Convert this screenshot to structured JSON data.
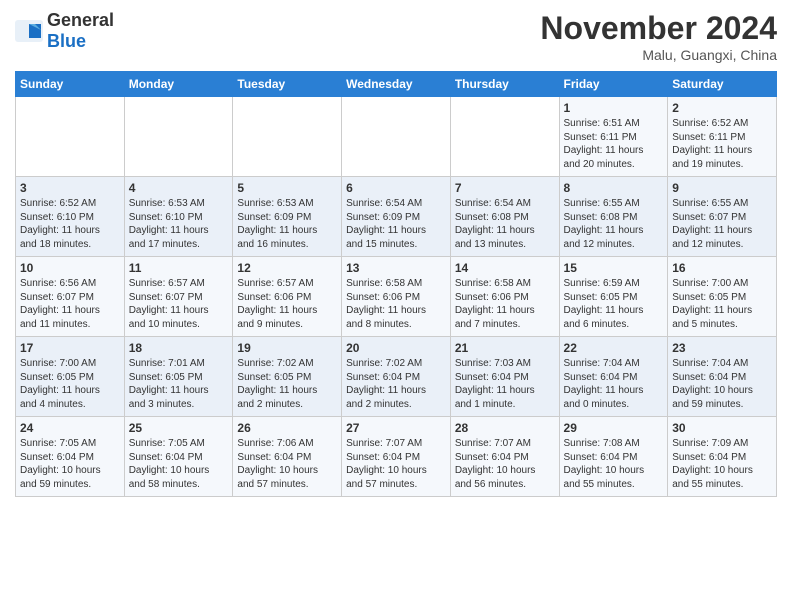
{
  "header": {
    "logo_general": "General",
    "logo_blue": "Blue",
    "month": "November 2024",
    "location": "Malu, Guangxi, China"
  },
  "weekdays": [
    "Sunday",
    "Monday",
    "Tuesday",
    "Wednesday",
    "Thursday",
    "Friday",
    "Saturday"
  ],
  "weeks": [
    [
      {
        "day": "",
        "content": ""
      },
      {
        "day": "",
        "content": ""
      },
      {
        "day": "",
        "content": ""
      },
      {
        "day": "",
        "content": ""
      },
      {
        "day": "",
        "content": ""
      },
      {
        "day": "1",
        "content": "Sunrise: 6:51 AM\nSunset: 6:11 PM\nDaylight: 11 hours\nand 20 minutes."
      },
      {
        "day": "2",
        "content": "Sunrise: 6:52 AM\nSunset: 6:11 PM\nDaylight: 11 hours\nand 19 minutes."
      }
    ],
    [
      {
        "day": "3",
        "content": "Sunrise: 6:52 AM\nSunset: 6:10 PM\nDaylight: 11 hours\nand 18 minutes."
      },
      {
        "day": "4",
        "content": "Sunrise: 6:53 AM\nSunset: 6:10 PM\nDaylight: 11 hours\nand 17 minutes."
      },
      {
        "day": "5",
        "content": "Sunrise: 6:53 AM\nSunset: 6:09 PM\nDaylight: 11 hours\nand 16 minutes."
      },
      {
        "day": "6",
        "content": "Sunrise: 6:54 AM\nSunset: 6:09 PM\nDaylight: 11 hours\nand 15 minutes."
      },
      {
        "day": "7",
        "content": "Sunrise: 6:54 AM\nSunset: 6:08 PM\nDaylight: 11 hours\nand 13 minutes."
      },
      {
        "day": "8",
        "content": "Sunrise: 6:55 AM\nSunset: 6:08 PM\nDaylight: 11 hours\nand 12 minutes."
      },
      {
        "day": "9",
        "content": "Sunrise: 6:55 AM\nSunset: 6:07 PM\nDaylight: 11 hours\nand 12 minutes."
      }
    ],
    [
      {
        "day": "10",
        "content": "Sunrise: 6:56 AM\nSunset: 6:07 PM\nDaylight: 11 hours\nand 11 minutes."
      },
      {
        "day": "11",
        "content": "Sunrise: 6:57 AM\nSunset: 6:07 PM\nDaylight: 11 hours\nand 10 minutes."
      },
      {
        "day": "12",
        "content": "Sunrise: 6:57 AM\nSunset: 6:06 PM\nDaylight: 11 hours\nand 9 minutes."
      },
      {
        "day": "13",
        "content": "Sunrise: 6:58 AM\nSunset: 6:06 PM\nDaylight: 11 hours\nand 8 minutes."
      },
      {
        "day": "14",
        "content": "Sunrise: 6:58 AM\nSunset: 6:06 PM\nDaylight: 11 hours\nand 7 minutes."
      },
      {
        "day": "15",
        "content": "Sunrise: 6:59 AM\nSunset: 6:05 PM\nDaylight: 11 hours\nand 6 minutes."
      },
      {
        "day": "16",
        "content": "Sunrise: 7:00 AM\nSunset: 6:05 PM\nDaylight: 11 hours\nand 5 minutes."
      }
    ],
    [
      {
        "day": "17",
        "content": "Sunrise: 7:00 AM\nSunset: 6:05 PM\nDaylight: 11 hours\nand 4 minutes."
      },
      {
        "day": "18",
        "content": "Sunrise: 7:01 AM\nSunset: 6:05 PM\nDaylight: 11 hours\nand 3 minutes."
      },
      {
        "day": "19",
        "content": "Sunrise: 7:02 AM\nSunset: 6:05 PM\nDaylight: 11 hours\nand 2 minutes."
      },
      {
        "day": "20",
        "content": "Sunrise: 7:02 AM\nSunset: 6:04 PM\nDaylight: 11 hours\nand 2 minutes."
      },
      {
        "day": "21",
        "content": "Sunrise: 7:03 AM\nSunset: 6:04 PM\nDaylight: 11 hours\nand 1 minute."
      },
      {
        "day": "22",
        "content": "Sunrise: 7:04 AM\nSunset: 6:04 PM\nDaylight: 11 hours\nand 0 minutes."
      },
      {
        "day": "23",
        "content": "Sunrise: 7:04 AM\nSunset: 6:04 PM\nDaylight: 10 hours\nand 59 minutes."
      }
    ],
    [
      {
        "day": "24",
        "content": "Sunrise: 7:05 AM\nSunset: 6:04 PM\nDaylight: 10 hours\nand 59 minutes."
      },
      {
        "day": "25",
        "content": "Sunrise: 7:05 AM\nSunset: 6:04 PM\nDaylight: 10 hours\nand 58 minutes."
      },
      {
        "day": "26",
        "content": "Sunrise: 7:06 AM\nSunset: 6:04 PM\nDaylight: 10 hours\nand 57 minutes."
      },
      {
        "day": "27",
        "content": "Sunrise: 7:07 AM\nSunset: 6:04 PM\nDaylight: 10 hours\nand 57 minutes."
      },
      {
        "day": "28",
        "content": "Sunrise: 7:07 AM\nSunset: 6:04 PM\nDaylight: 10 hours\nand 56 minutes."
      },
      {
        "day": "29",
        "content": "Sunrise: 7:08 AM\nSunset: 6:04 PM\nDaylight: 10 hours\nand 55 minutes."
      },
      {
        "day": "30",
        "content": "Sunrise: 7:09 AM\nSunset: 6:04 PM\nDaylight: 10 hours\nand 55 minutes."
      }
    ]
  ]
}
